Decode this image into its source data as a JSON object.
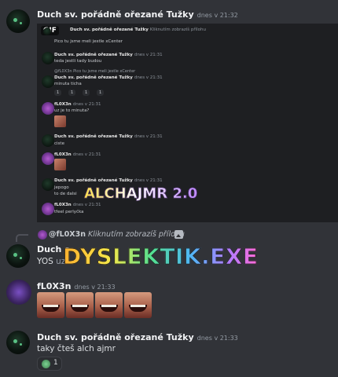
{
  "messages": [
    {
      "author": "Duch sv. pořádně ořezané Tužky",
      "time": "dnes v 21:32"
    },
    {
      "author": "Duch s",
      "text": "YOS",
      "trail": "uz"
    },
    {
      "author": "fL0X3n",
      "time": "dnes v 21:33"
    },
    {
      "author": "Duch sv. pořádně ořezané Tužky",
      "time": "dnes v 21:33",
      "text": "taky čteš alch ajmr",
      "reaction_count": "1"
    }
  ],
  "reply": {
    "author": "@fL0X3n",
    "text": "Kliknutím zobrazíš přílohu"
  },
  "gif": {
    "label": "GIF",
    "lines": [
      {
        "name": "Duch sv. pořádně ořezané Tužky",
        "text": "Kliknutím zobrazíš přílohu"
      },
      {
        "text": "Pico tu jsme meli jestle xCenter"
      },
      {
        "name": "Duch sv. pořádně ořezané Tužky",
        "time": "dnes v 21:31"
      },
      {
        "text": "teda jestli tady budou"
      },
      {
        "reply": "@fL0X3n Pico tu jsme meli jestle xCenter"
      },
      {
        "name": "Duch sv. pořádně ořezané Tužky",
        "time": "dnes v 21:31"
      },
      {
        "text": "minuta ticha"
      },
      {
        "react": [
          "1",
          "1",
          "1",
          "1"
        ]
      },
      {
        "name": "fL0X3n",
        "time": "dnes v 21:31"
      },
      {
        "text": "uz je to minuta?"
      },
      {
        "name": "Duch sv. pořádně ořezané Tužky",
        "time": "dnes v 21:31"
      },
      {
        "text": "ciste"
      },
      {
        "name": "fL0X3n",
        "time": "dnes v 21:31"
      },
      {
        "name": "Duch sv. pořádně ořezané Tužky",
        "time": "dnes v 21:31"
      },
      {
        "text": "jepogo"
      },
      {
        "text": "to de dalsi"
      },
      {
        "name": "fL0X3n",
        "time": "dnes v 21:31"
      },
      {
        "text": "tfeel perlyčka"
      }
    ]
  },
  "overlay": {
    "small": "ALCHAJMR 2.0",
    "big": "DYSLEKTIK.EXE"
  },
  "colors": {
    "background": "#313338",
    "author": "#f2f3f5",
    "timestamp": "#949ba4"
  }
}
